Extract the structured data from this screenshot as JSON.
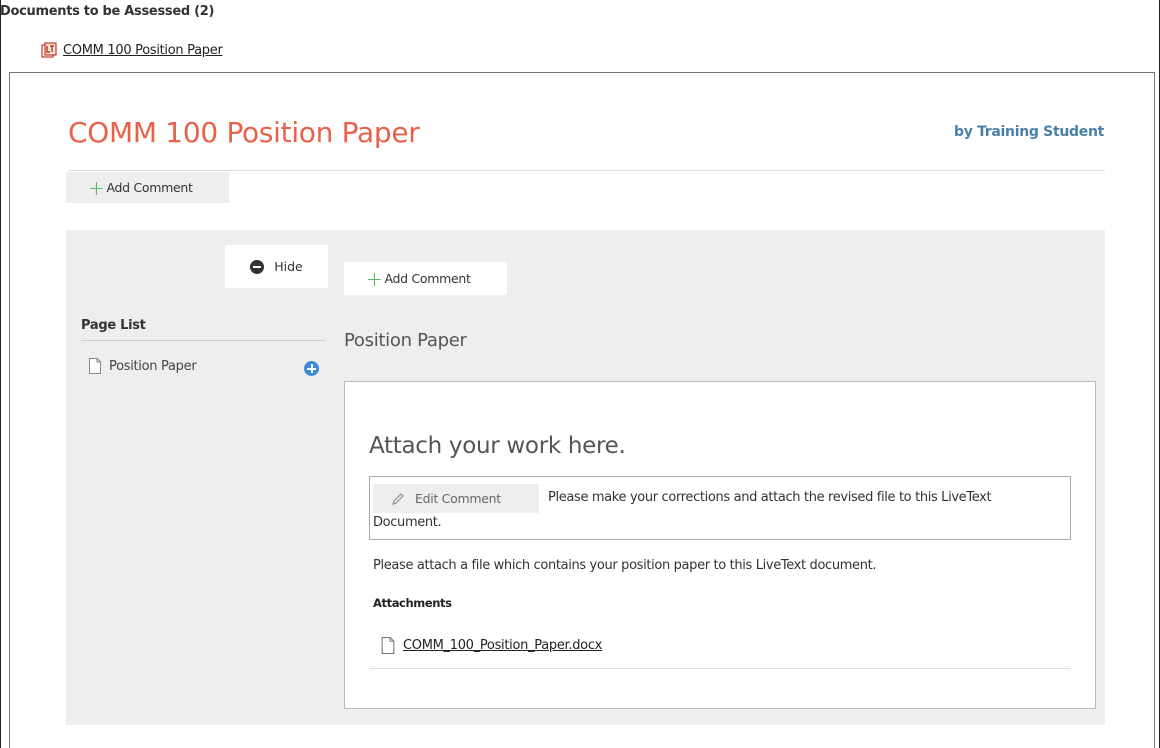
{
  "docs": {
    "header": "Documents to be Assessed (2)",
    "link_label": "COMM 100 Position Paper",
    "icon": "livetext-document-icon"
  },
  "document": {
    "title": "COMM 100 Position Paper",
    "author": "by Training Student",
    "add_comment_label": "Add Comment"
  },
  "sidebar": {
    "hide_label": "Hide",
    "page_list_title": "Page List",
    "items": [
      {
        "label": "Position Paper",
        "icon": "page-icon"
      }
    ]
  },
  "main": {
    "add_comment_label": "Add Comment",
    "section_title": "Position Paper",
    "content_heading": "Attach your work here.",
    "comment": {
      "edit_label": "Edit Comment",
      "text_line1": "Please make your corrections and attach the revised file to this LiveText",
      "text_line2": "Document."
    },
    "instruction": "Please attach a file which contains your position paper to this LiveText document.",
    "attachments_label": "Attachments",
    "attachments": [
      {
        "filename": "COMM_100_Position_Paper.docx",
        "icon": "file-icon"
      }
    ]
  },
  "colors": {
    "title": "#e8614a",
    "author": "#4a7fa8",
    "plus": "#4caf50",
    "add_page": "#3a8ed8",
    "panel_bg": "#eeeeee"
  }
}
